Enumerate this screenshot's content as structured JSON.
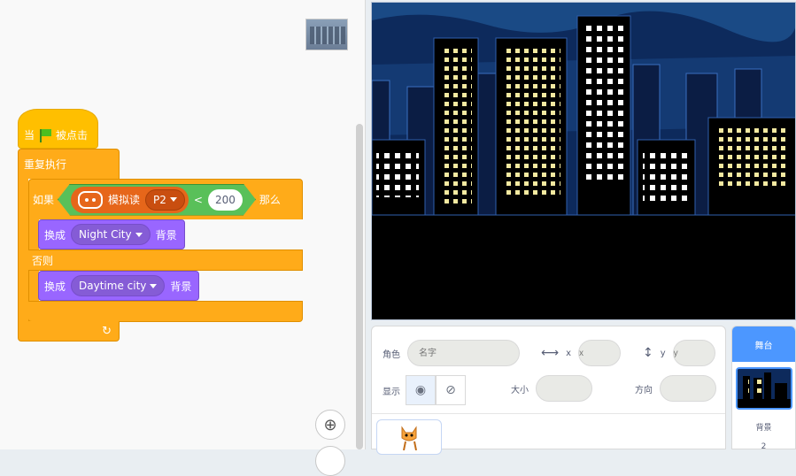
{
  "scripts": {
    "when_flag": {
      "prefix": "当",
      "suffix": "被点击"
    },
    "forever": "重复执行",
    "if": {
      "label": "如果",
      "then": "那么",
      "else": "否则"
    },
    "condition": {
      "reporter": "模拟读",
      "pin": "P2",
      "operator": "<",
      "value": "200"
    },
    "switch_then": {
      "label": "换成",
      "backdrop": "Night City",
      "suffix": "背景"
    },
    "switch_else": {
      "label": "换成",
      "backdrop": "Daytime city",
      "suffix": "背景"
    }
  },
  "sprite_info": {
    "sprite_label": "角色",
    "name_placeholder": "名字",
    "x_label": "x",
    "x_placeholder": "x",
    "y_label": "y",
    "y_placeholder": "y",
    "show_label": "显示",
    "size_label": "大小",
    "direction_label": "方向"
  },
  "stage_tab": {
    "title": "舞台",
    "backdrops_label": "背景",
    "backdrops_count": "2"
  },
  "icons": [
    "green-flag-icon",
    "microbit-icon",
    "dropdown-caret-icon",
    "loop-arrow-icon",
    "zoom-in-icon",
    "eye-icon",
    "eye-off-icon",
    "arrows-horizontal-icon",
    "arrows-vertical-icon",
    "cat-sprite-icon"
  ]
}
